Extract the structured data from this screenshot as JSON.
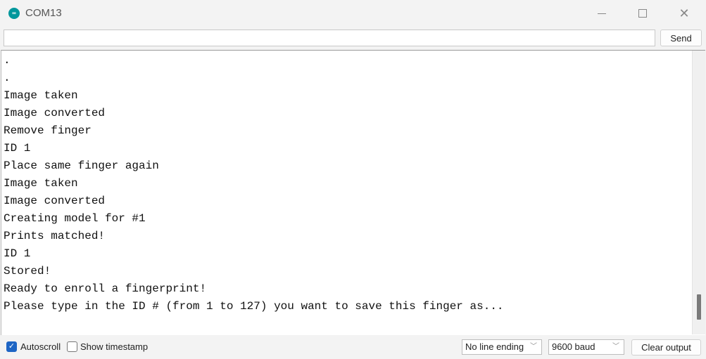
{
  "window": {
    "title": "COM13",
    "app_icon": "arduino-icon",
    "controls": {
      "minimize": "—",
      "maximize": "",
      "close": "✕"
    }
  },
  "send_bar": {
    "input_value": "",
    "input_placeholder": "",
    "send_label": "Send"
  },
  "output": {
    "lines": [
      ".",
      ".",
      "Image taken",
      "Image converted",
      "Remove finger",
      "ID 1",
      "Place same finger again",
      "Image taken",
      "Image converted",
      "Creating model for #1",
      "Prints matched!",
      "ID 1",
      "Stored!",
      "Ready to enroll a fingerprint!",
      "Please type in the ID # (from 1 to 127) you want to save this finger as..."
    ]
  },
  "bottom_bar": {
    "autoscroll": {
      "label": "Autoscroll",
      "checked": true,
      "check_glyph": "✓"
    },
    "show_timestamp": {
      "label": "Show timestamp",
      "checked": false
    },
    "line_ending": {
      "selected": "No line ending",
      "chevron": "﹀"
    },
    "baud_rate": {
      "selected": "9600 baud",
      "chevron": "﹀"
    },
    "clear_label": "Clear output"
  },
  "colors": {
    "accent": "#1e65c4",
    "arduino_teal": "#00979c"
  }
}
